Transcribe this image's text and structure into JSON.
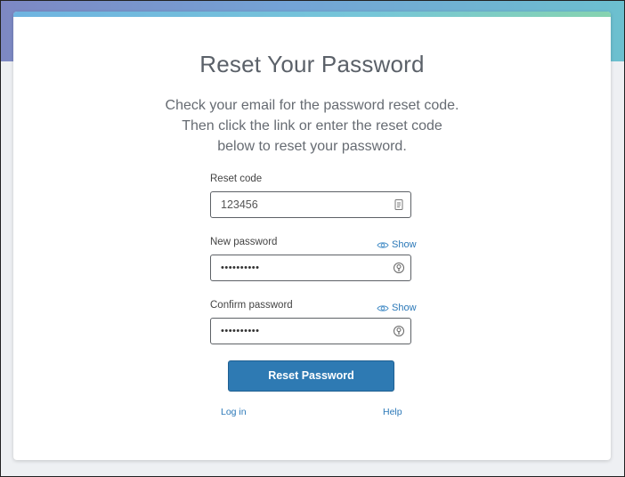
{
  "page": {
    "title": "Reset Your Password",
    "instructions": [
      "Check your email for the password reset code.",
      "Then click the link or enter the reset code",
      "below to reset your password."
    ]
  },
  "form": {
    "reset_code": {
      "label": "Reset code",
      "value": "123456",
      "icon": "id-card-icon"
    },
    "new_password": {
      "label": "New password",
      "value": "••••••••••",
      "show_label": "Show",
      "icon": "password-key-icon"
    },
    "confirm_password": {
      "label": "Confirm password",
      "value": "••••••••••",
      "show_label": "Show",
      "icon": "password-key-icon"
    },
    "submit_label": "Reset Password"
  },
  "footer": {
    "login_label": "Log in",
    "help_label": "Help"
  },
  "colors": {
    "accent": "#2e7ab3",
    "link": "#2b78b8",
    "title": "#5b6169"
  }
}
